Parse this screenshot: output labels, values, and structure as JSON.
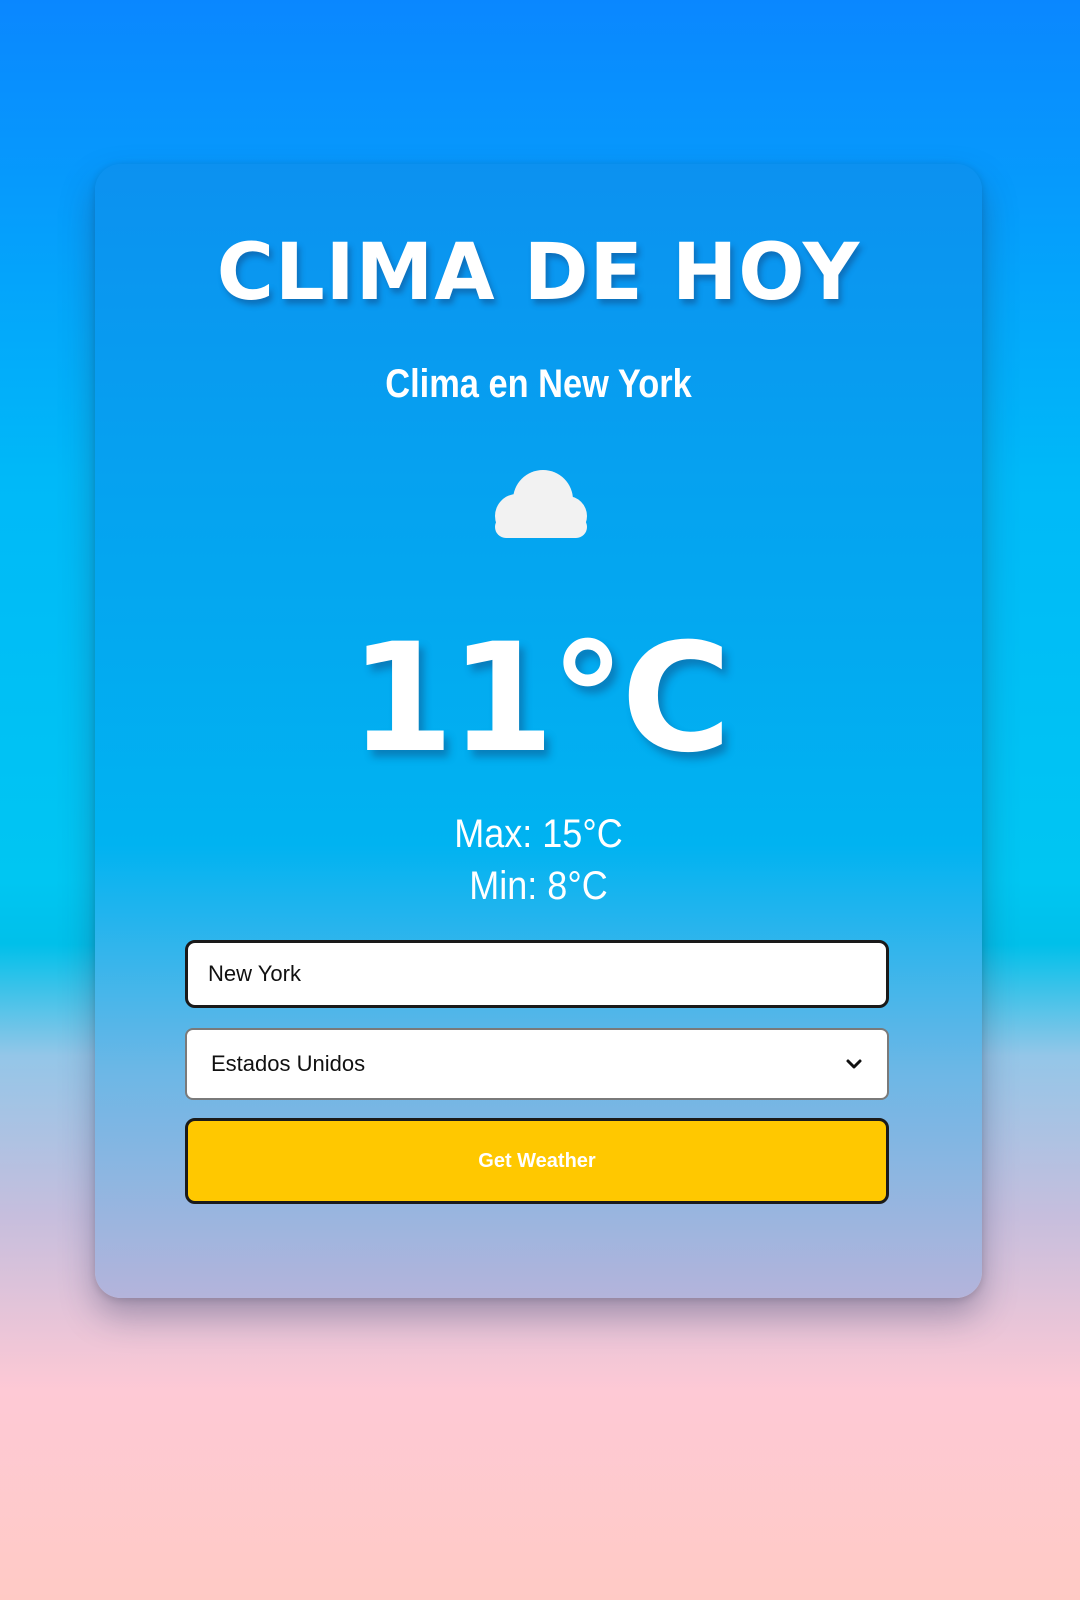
{
  "card": {
    "title": "CLIMA DE HOY",
    "location_heading": "Clima en New York",
    "weather_icon": "cloud-icon",
    "temperature": "11°C",
    "max": "Max: 15°C",
    "min": "Min: 8°C"
  },
  "form": {
    "city_value": "New York",
    "country_selected": "Estados Unidos",
    "submit_label": "Get Weather"
  },
  "colors": {
    "button": "#ffc800",
    "text": "#ffffff"
  }
}
